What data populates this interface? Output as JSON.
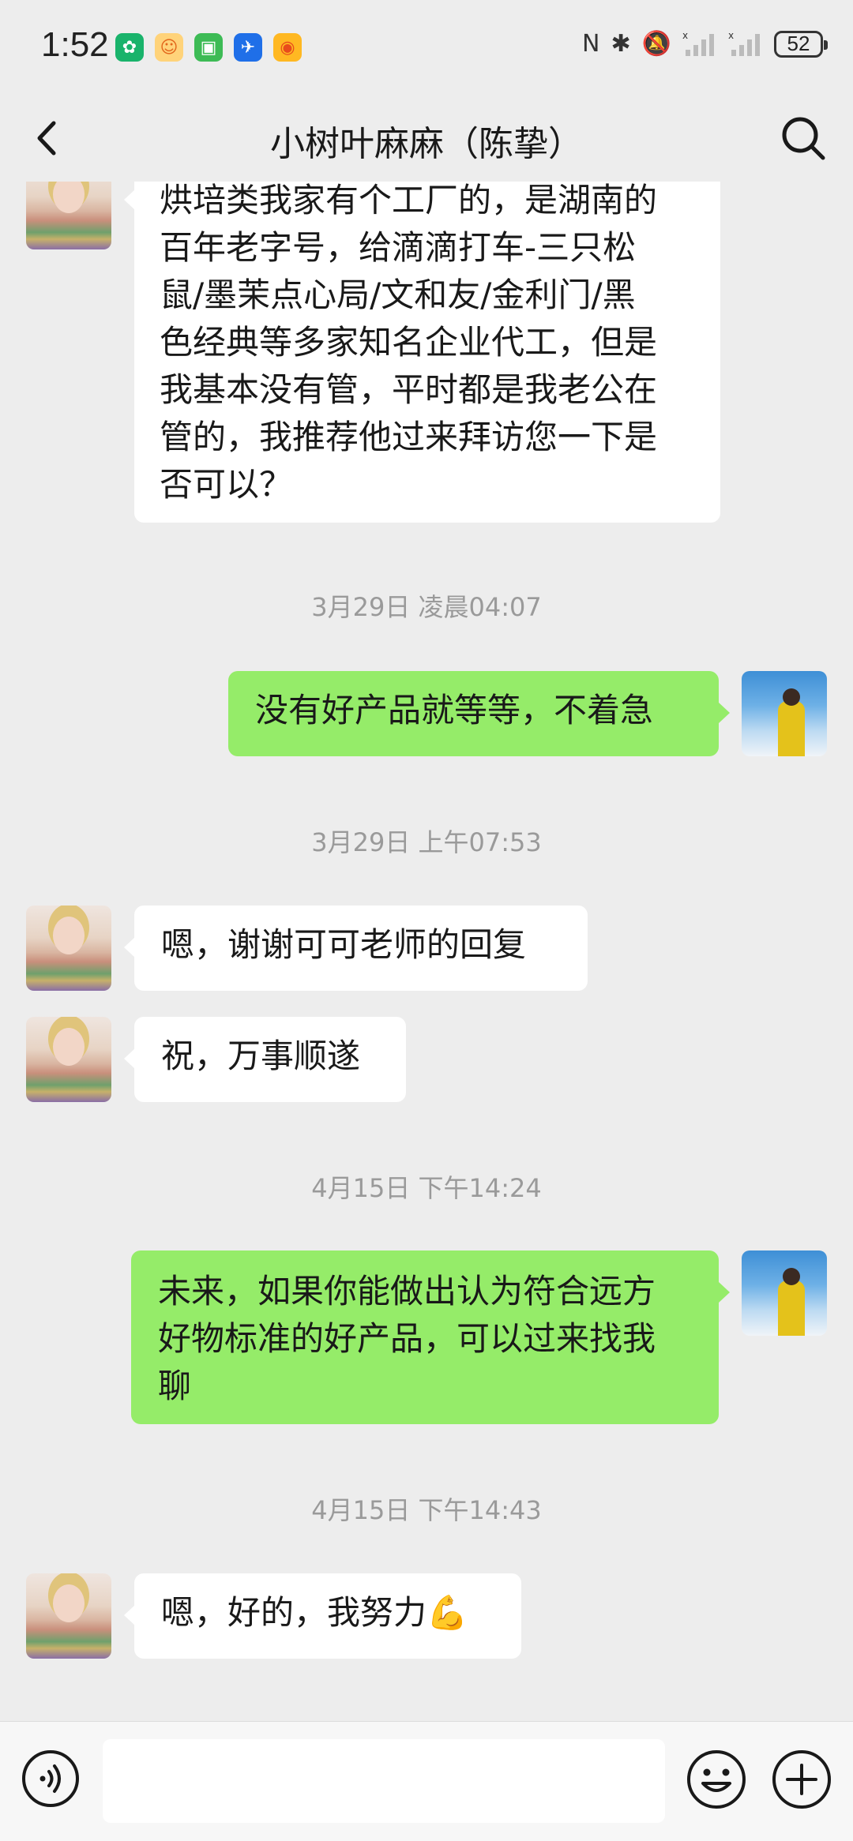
{
  "status_bar": {
    "time": "1:52",
    "battery": "52"
  },
  "header": {
    "title": "小树叶麻麻（陈挚）"
  },
  "messages": [
    {
      "side": "left",
      "text": "烘培类我家有个工厂的，是湖南的\n百年老字号，给滴滴打车-三只松\n鼠/墨茉点心局/文和友/金利门/黑\n色经典等多家知名企业代工，但是\n我基本没有管，平时都是我老公在\n管的，我推荐他过来拜访您一下是\n否可以？"
    },
    {
      "timestamp": "3月29日 凌晨04:07"
    },
    {
      "side": "right",
      "text": "没有好产品就等等，不着急"
    },
    {
      "timestamp": "3月29日 上午07:53"
    },
    {
      "side": "left",
      "text": "嗯，谢谢可可老师的回复"
    },
    {
      "side": "left",
      "text": "祝，万事顺遂"
    },
    {
      "timestamp": "4月15日 下午14:24"
    },
    {
      "side": "right",
      "text": "未来，如果你能做出认为符合远方\n好物标准的好产品，可以过来找我\n聊"
    },
    {
      "timestamp": "4月15日 下午14:43"
    },
    {
      "side": "left",
      "text": "嗯，好的，我努力💪"
    }
  ],
  "input": {
    "value": ""
  },
  "icons": {
    "back": "chevron-left-icon",
    "search": "search-icon",
    "voice": "voice-icon",
    "emoji": "emoji-icon",
    "plus": "plus-icon"
  },
  "colors": {
    "background": "#ededed",
    "bubble_self": "#95ec69",
    "bubble_other": "#ffffff",
    "timestamp_text": "#9a9a9a"
  }
}
